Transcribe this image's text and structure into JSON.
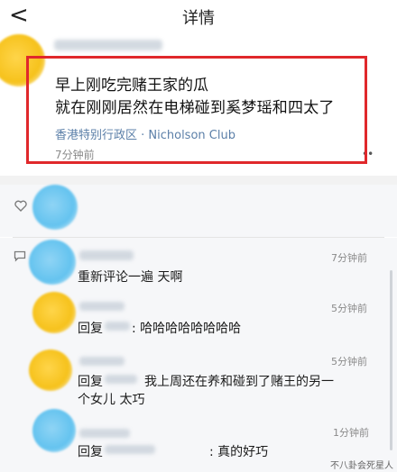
{
  "nav": {
    "back_glyph": "<",
    "title": "详情"
  },
  "post": {
    "line1": "早上刚吃完赌王家的瓜",
    "line2": "就在刚刚居然在电梯碰到奚梦瑶和四太了",
    "location": "香港特别行政区 · Nicholson Club",
    "time": "7分钟前",
    "more": "••"
  },
  "icons": {
    "like": "heart-icon",
    "comment": "comment-icon"
  },
  "comments": [
    {
      "text": "重新评论一遍 天啊",
      "time": "7分钟前"
    },
    {
      "prefix": "回复",
      "text": ": 哈哈哈哈哈哈哈哈",
      "time": "5分钟前"
    },
    {
      "prefix": "回复",
      "text": "我上周还在养和碰到了赌王的另一",
      "text2": "个女儿 太巧",
      "time": "5分钟前"
    },
    {
      "prefix": "回复",
      "text": ": 真的好巧",
      "time": "1分钟前"
    }
  ],
  "watermark": "不八卦会死星人",
  "colors": {
    "highlight": "#e0282b",
    "location": "#5b7fa8",
    "background": "#f6f7f9"
  }
}
